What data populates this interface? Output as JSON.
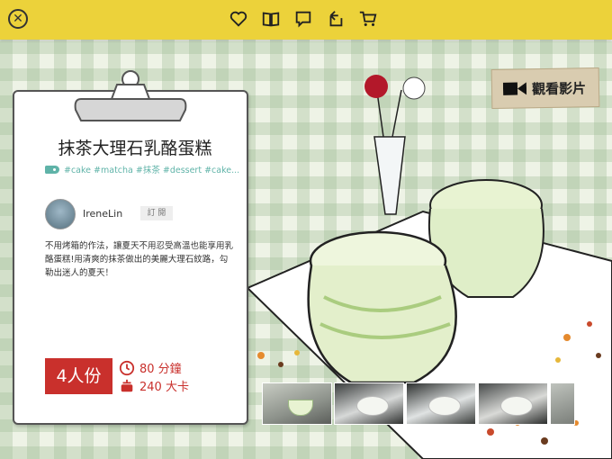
{
  "toolbar": {
    "icons": [
      "close-icon",
      "heart-icon",
      "book-icon",
      "comment-icon",
      "share-icon",
      "cart-icon"
    ]
  },
  "video": {
    "label": "觀看影片"
  },
  "recipe": {
    "title": "抹茶大理石乳酪蛋糕",
    "tags": "#cake #matcha #抹茶 #dessert #cake...",
    "author": "IreneLin",
    "subscribe": "訂 閱",
    "description": "不用烤箱的作法，讓夏天不用忍受高溫也能享用乳酪蛋糕!用清爽的抹茶做出的美麗大理石紋路，勾勒出迷人的夏天！",
    "servings": "4人份",
    "time": "80 分鐘",
    "calories": "240 大卡"
  },
  "colors": {
    "topbar": "#ecd23a",
    "accent": "#c9302c",
    "tag": "#5fb3a8"
  }
}
